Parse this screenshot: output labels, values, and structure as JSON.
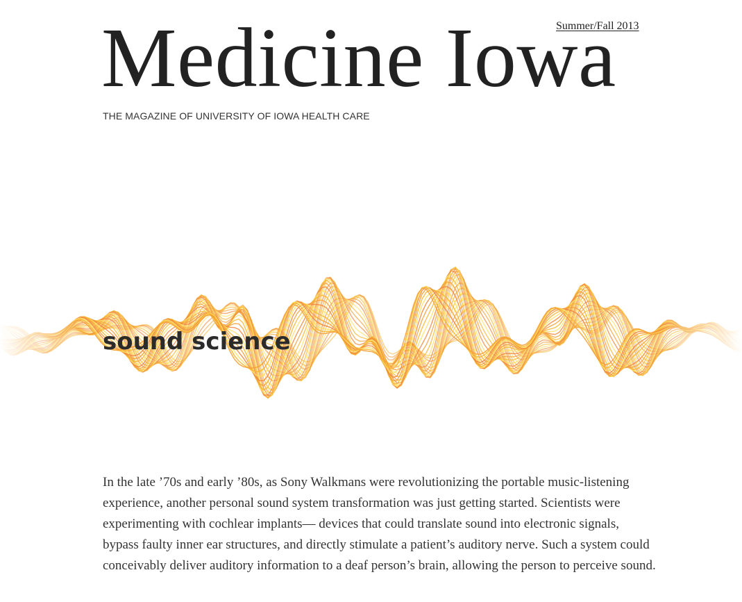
{
  "header": {
    "issue": "Summer/Fall 2013",
    "title": "Medicine Iowa",
    "tagline": "THE MAGAZINE OF UNIVERSITY OF IOWA HEALTH CARE"
  },
  "feature": {
    "title": "sound science",
    "art_colors": [
      "#f7b733",
      "#f4a13a",
      "#f0873c",
      "#ffe066"
    ]
  },
  "article": {
    "paragraph": "In the late ’70s and early ’80s, as Sony Walkmans were revolutionizing the portable music-listening experience, another personal sound system transformation was just getting started. Scientists were experimenting with cochlear implants— devices that could translate sound into electronic signals, bypass faulty inner ear structures, and directly stimulate a patient’s auditory nerve. Such a system could conceivably deliver auditory information to a deaf person’s brain, allowing the person to perceive sound."
  }
}
